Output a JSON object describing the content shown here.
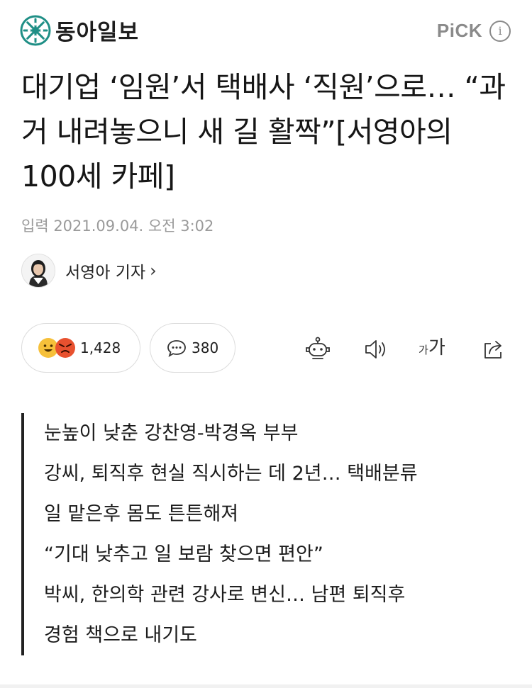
{
  "header": {
    "logo_text": "동아일보",
    "pick_label": "PiCK",
    "info_symbol": "i"
  },
  "article": {
    "title": "대기업 ‘임원’서 택배사 ‘직원’으로… “과거 내려놓으니 새 길 활짝”[서영아의 100세 카페]",
    "date": "입력 2021.09.04. 오전 3:02",
    "author": "서영아 기자",
    "author_chevron": "›"
  },
  "actions": {
    "reaction_count": "1,428",
    "comment_count": "380",
    "fontsize_small": "가",
    "fontsize_large": "가"
  },
  "summary": [
    "눈높이 낮춘 강찬영-박경옥 부부",
    "강씨, 퇴직후 현실 직시하는 데 2년… 택배분류",
    "일 맡은후 몸도 튼튼해져",
    "“기대 낮추고 일 보람 찾으면 편안”",
    "박씨, 한의학 관련 강사로 변신… 남편 퇴직후",
    "경험 책으로 내기도"
  ],
  "colors": {
    "brand_teal": "#1f8f86",
    "reaction_yellow": "#f6c03a",
    "reaction_red": "#e8512f"
  },
  "icons": [
    "dongA-logo-icon",
    "info-icon",
    "smile-emoji-icon",
    "angry-emoji-icon",
    "comment-icon",
    "robot-icon",
    "speaker-icon",
    "share-icon"
  ]
}
